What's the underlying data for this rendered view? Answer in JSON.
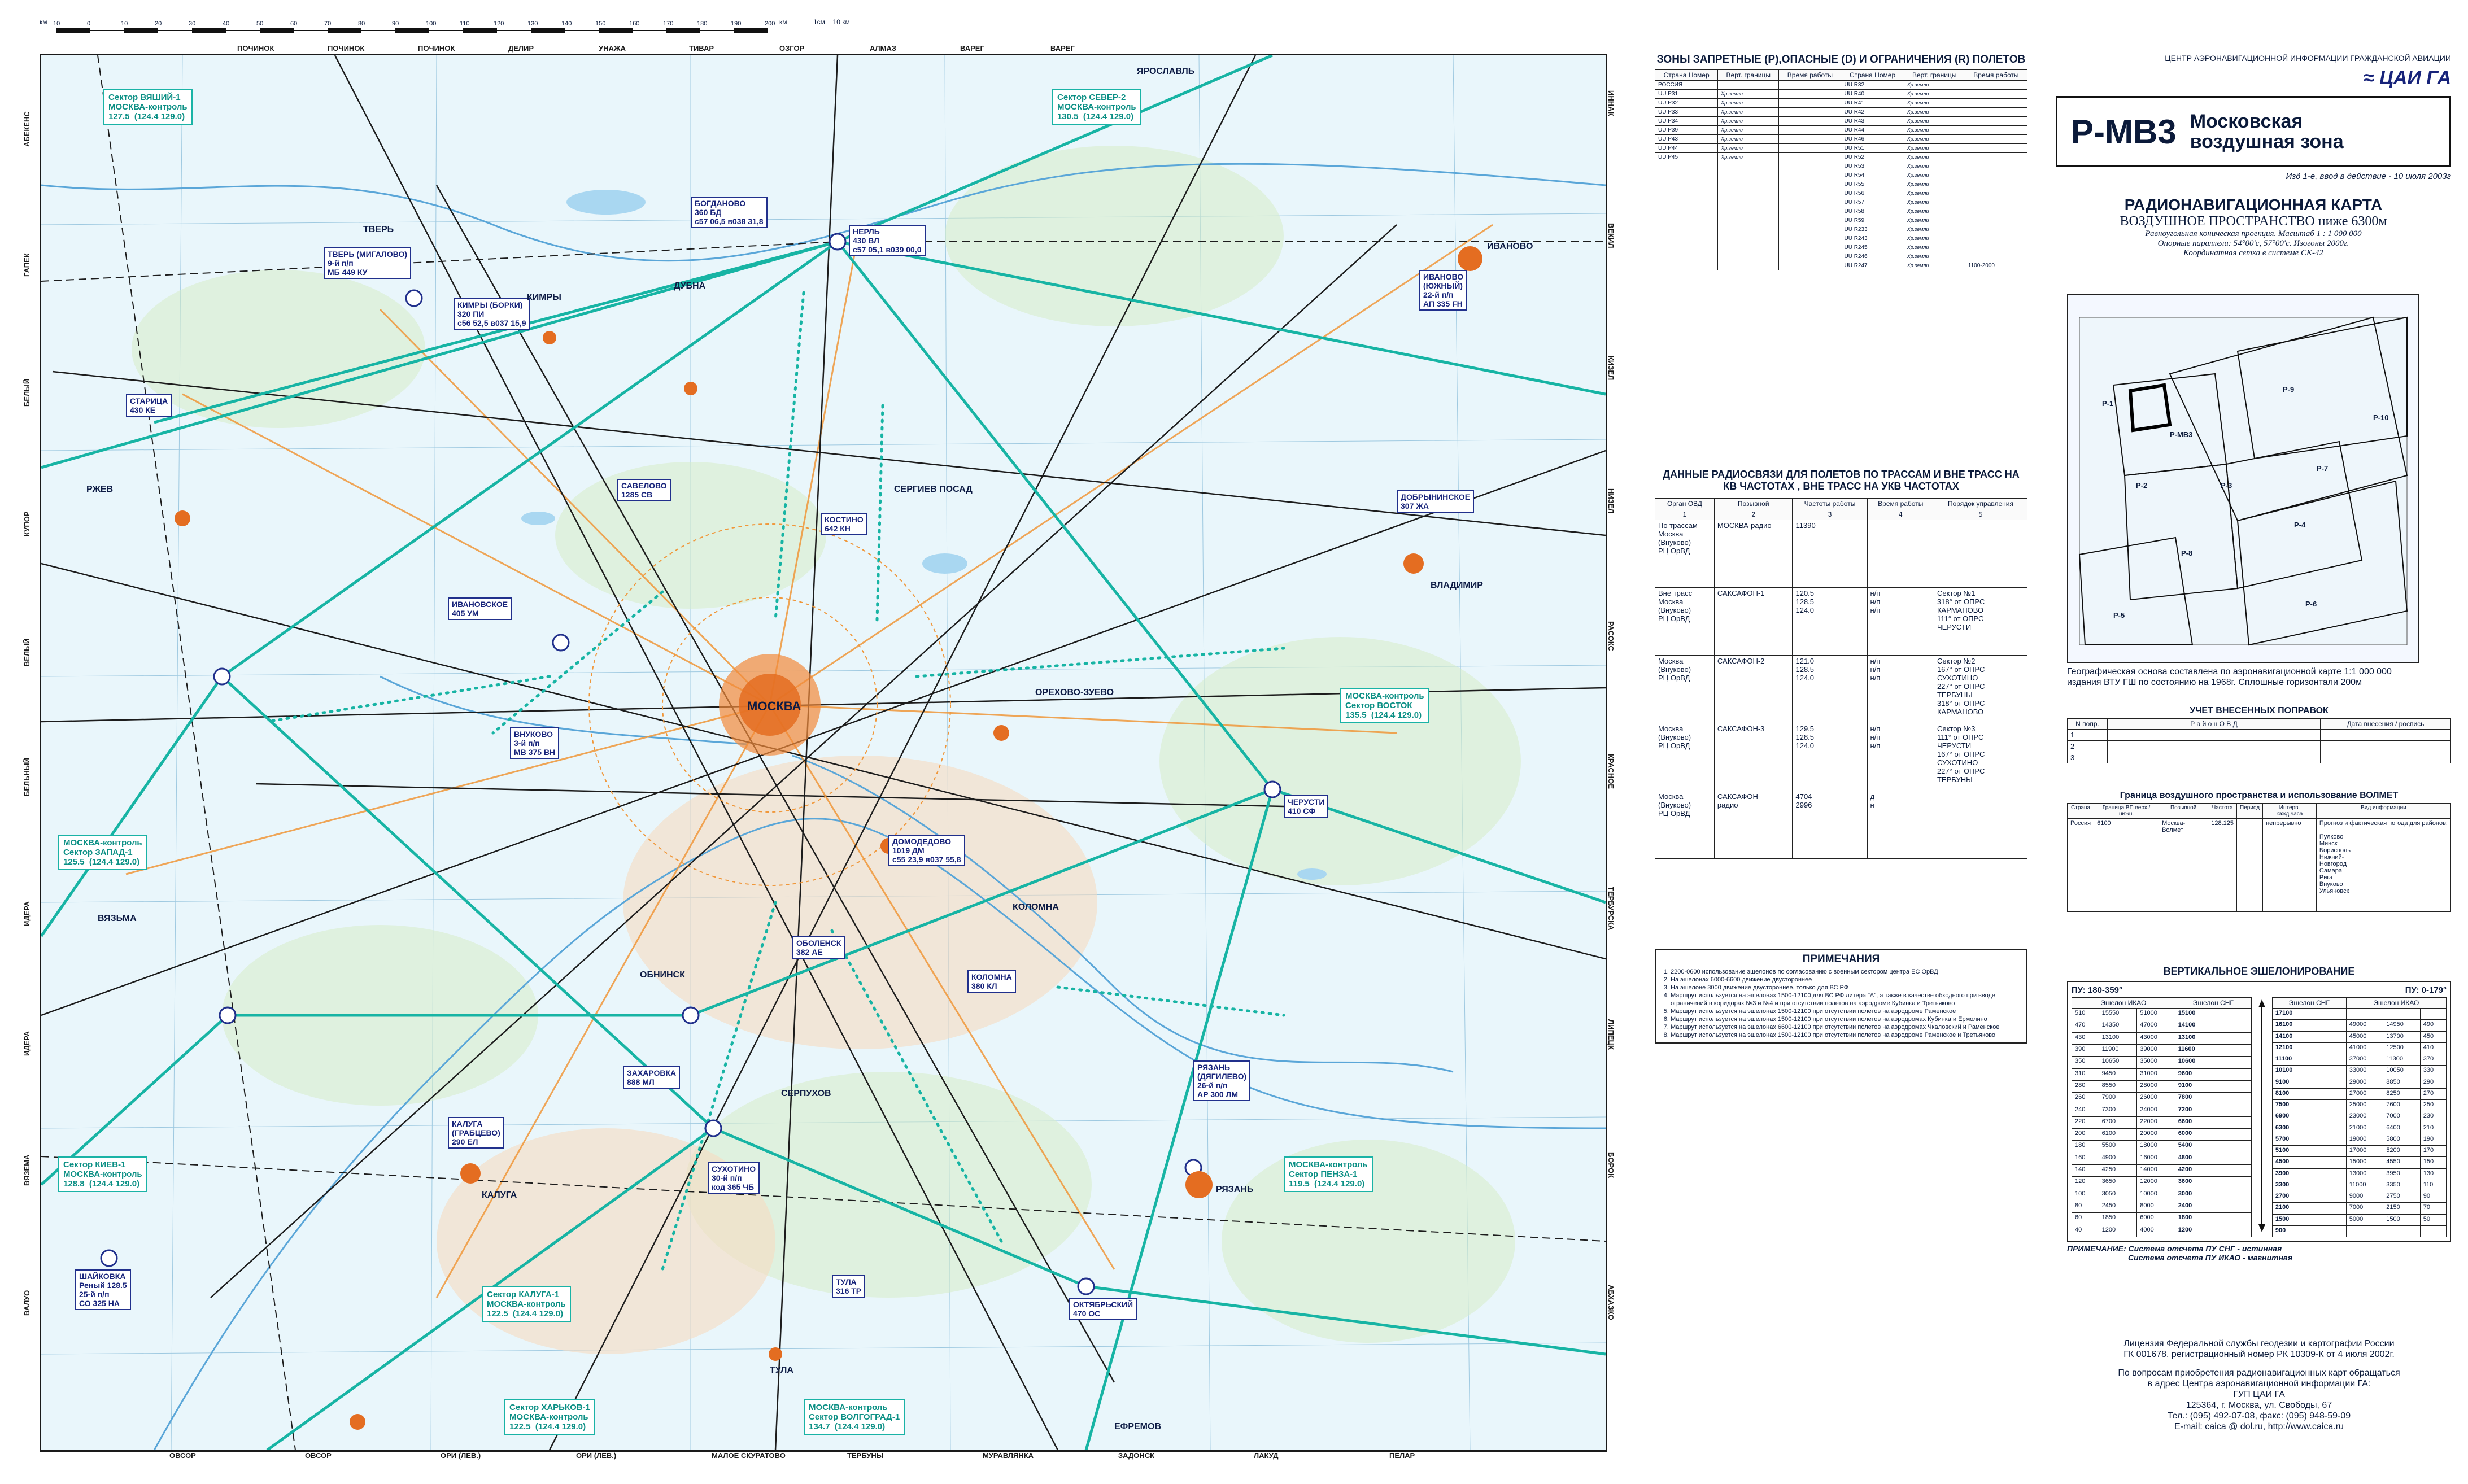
{
  "scale": {
    "label_km": "км",
    "ticks": [
      "10",
      "0",
      "10",
      "20",
      "30",
      "40",
      "50",
      "60",
      "70",
      "80",
      "90",
      "100",
      "110",
      "120",
      "130",
      "140",
      "150",
      "160",
      "170",
      "180",
      "190",
      "200"
    ],
    "unit_right": "км",
    "ratio_note": "1см = 10 км"
  },
  "edge_labels": {
    "top": [
      "ПОЧИНОК",
      "ПОЧИНОК",
      "ПОЧИНОК",
      "ДЕЛИР",
      "УНАЖА",
      "ТИВАР",
      "ОЗГОР",
      "АЛМАЗ",
      "ВАРЕГ",
      "ВАРЕГ"
    ],
    "bottom": [
      "ОВСОР",
      "ОВСОР",
      "ОРИ (ЛЕВ.)",
      "ОРИ (ЛЕВ.)",
      "МАЛОЕ СКУРАТОВО",
      "ТЕРБУНЫ",
      "МУРАВЛЯНКА",
      "ЗАДОНСК",
      "ЛАКУД",
      "ПЕЛАР"
    ],
    "left": [
      "АБЕКЕНС",
      "ГАПЕК",
      "БЕЛЫЙ",
      "КУПОР",
      "ВЕЛЫЙ",
      "БЕЛЬНЫЙ",
      "ИДЕРА",
      "ИДЕРА",
      "ВЯЗЕМА",
      "ВАЛУО"
    ],
    "right": [
      "ИННАК",
      "ВЕКИЛ",
      "КИЗЕЛ",
      "НИЗЕЛ",
      "РАСОКС",
      "КРАСНОЕ",
      "ТЕРБУРСКА",
      "ЛИПЕЦК",
      "БОРОК",
      "АБХАЗКО"
    ]
  },
  "stations": [
    {
      "id": "boldanovo",
      "text": "БОГДАНОВО\n360 БД\nс57 06,5 в038 31,8"
    },
    {
      "id": "nerl",
      "text": "НЕРЛЬ\n430 ВЛ\nс57 05,1 в039 00,0"
    },
    {
      "id": "tver",
      "text": "ТВЕРЬ (МИГАЛОВО)\n9-й п/п\nМБ 449 КУ"
    },
    {
      "id": "staritsa",
      "text": "СТАРИЦА\n430 КЕ"
    },
    {
      "id": "kimry",
      "text": "КИМРЫ (БОРКИ)\n320 ПИ\nс56 52,5 в037 15,9"
    },
    {
      "id": "savelovo",
      "text": "САВЕЛОВО\n1285 СВ"
    },
    {
      "id": "kostino",
      "text": "КОСТИНО\n642 КН"
    },
    {
      "id": "ivanovo",
      "text": "ИВАНОВО\n(ЮЖНЫЙ)\n22-й п/п\nАП 335 FH"
    },
    {
      "id": "dobryninskoe",
      "text": "ДОБРЫНИНСКОЕ\n307 ЖА"
    },
    {
      "id": "ivanovskoe",
      "text": "ИВАНОВСКОЕ\n405 УМ"
    },
    {
      "id": "cherusti",
      "text": "ЧЕРУСТИ\n410 СФ"
    },
    {
      "id": "oblast",
      "text": "ОБОЛЕНСК\n382 АЕ"
    },
    {
      "id": "zakharovka",
      "text": "ЗАХАРОВКА\n888 МЛ"
    },
    {
      "id": "kaluga",
      "text": "КАЛУГА\n(ГРАБЦЕВО)\n290 ЕЛ"
    },
    {
      "id": "dom",
      "text": "ДОМОДЕДОВО\n1019 ДМ\nс55 23,9 в037 55,8"
    },
    {
      "id": "kolomna",
      "text": "КОЛОМНА\n380 КЛ"
    },
    {
      "id": "ryazan",
      "text": "РЯЗАНЬ\n(ДЯГИЛЕВО)\n26-й п/п\nАР 300 ЛМ"
    },
    {
      "id": "sukhotino",
      "text": "СУХОТИНО\n30-й п/п\nкод 365 ЧБ"
    },
    {
      "id": "oktyabr",
      "text": "ОКТЯБРЬСКИЙ\n470 ОС"
    },
    {
      "id": "shaikovka",
      "text": "ШАЙКОВКА\nРеный 128.5\n25-й п/п\nСО 325 НА"
    },
    {
      "id": "vnukovo",
      "text": "ВНУКОВО\n3-й п/п\nМВ 375 ВН"
    },
    {
      "id": "tula",
      "text": "ТУЛА\n316 ТР"
    }
  ],
  "freq_boxes": [
    {
      "id": "tver_ctrl",
      "text": "Сектор ВЯШИЙ-1\nМОСКВА-контроль\n127.5  (124.4 129.0)"
    },
    {
      "id": "moskva_top",
      "text": "Сектор СЕВЕР-2\nМОСКВА-контроль\n130.5  (124.4 129.0)"
    },
    {
      "id": "moskva_west",
      "text": "МОСКВА-контроль\nСектор ЗАПАД-1\n125.5  (124.4 129.0)"
    },
    {
      "id": "moskva_east",
      "text": "МОСКВА-контроль\nСектор ВОСТОК\n135.5  (124.4 129.0)"
    },
    {
      "id": "moskva_kiev",
      "text": "Сектор КИЕВ-1\nМОСКВА-контроль\n128.8  (124.4 129.0)"
    },
    {
      "id": "moskva_kaluga",
      "text": "Сектор КАЛУГА-1\nМОСКВА-контроль\n122.5  (124.4 129.0)"
    },
    {
      "id": "moskva_south",
      "text": "МОСКВА-контроль\nСектор ПЕНЗА-1\n119.5  (124.4 129.0)"
    },
    {
      "id": "moskva_kharkov",
      "text": "Сектор ХАРЬКОВ-1\nМОСКВА-контроль\n122.5  (124.4 129.0)"
    },
    {
      "id": "moskva_volgograd",
      "text": "МОСКВА-контроль\nСектор ВОЛГОГРАД-1\n134.7  (124.4 129.0)"
    }
  ],
  "cities": [
    "ТВЕРЬ",
    "КИМРЫ",
    "ДУБНА",
    "ИВАНОВО",
    "ВЛАДИМИР",
    "МОСКВА",
    "СЕРГИЕВ ПОСАД",
    "РЯЗАНЬ",
    "КАЛУГА",
    "ТУЛА",
    "СЕРПУХОВ",
    "КОЛОМНА",
    "ОРЕХОВО-ЗУЕВО",
    "ЯРОСЛАВЛЬ",
    "РЖЕВ",
    "ВЯЗЬМА",
    "ОБНИНСК",
    "ЕФРЕМОВ"
  ],
  "header": {
    "agency": "ЦЕНТР АЭРОНАВИГАЦИОННОЙ ИНФОРМАЦИИ ГРАЖДАНСКОЙ АВИАЦИИ",
    "logo": "ЦАИ ГА",
    "code": "Р-МВ3",
    "zone": "Московская воздушная зона",
    "edition": "Изд 1-е, ввод в действие - 10 июля 2003г"
  },
  "chart_title": {
    "line1": "РАДИОНАВИГАЦИОННАЯ КАРТА",
    "line2": "ВОЗДУШНОЕ ПРОСТРАНСТВО ниже 6300м",
    "line3": "Равноугольная коническая проекция. Масштаб  1 : 1 000 000",
    "line4": "Опорные параллели: 54°00'с, 57°00'с. Изогоны 2000г.",
    "line5": "Координатная сетка в системе СК-42"
  },
  "index_map": {
    "labels": [
      "Р-1",
      "Р-9",
      "Р-МВ3",
      "Р-2",
      "Р-3",
      "Р-4",
      "Р-7",
      "Р-8",
      "Р-5",
      "Р-6",
      "Р-10"
    ],
    "note": "Географическая основа составлена по аэронавигационной карте 1:1 000 000 издания ВТУ ГШ по состоянию на 1968г. Сплошные горизонтали 200м"
  },
  "zones_table": {
    "title": "ЗОНЫ ЗАПРЕТНЫЕ (Р),ОПАСНЫЕ (D) И ОГРАНИЧЕНИЯ (R) ПОЛЕТОВ",
    "headers": [
      "Страна Номер",
      "Верт. границы",
      "Время работы",
      "Страна Номер",
      "Верт. границы",
      "Время работы"
    ],
    "country": "РОССИЯ",
    "left": [
      "UU P31",
      "UU P32",
      "UU P33",
      "UU P34",
      "UU P39",
      "UU P43",
      "UU P44",
      "UU P45"
    ],
    "right": [
      "UU R32",
      "UU R40",
      "UU R41",
      "UU R42",
      "UU R43",
      "UU R44",
      "UU R46",
      "UU R51",
      "UU R52",
      "UU R53",
      "UU R54",
      "UU R55",
      "UU R56",
      "UU R57",
      "UU R58",
      "UU R59",
      "UU R233",
      "UU R243",
      "UU R245",
      "UU R246",
      "UU R247"
    ],
    "limit": "Хр.земли",
    "last_time": "1100-2000"
  },
  "radio_table": {
    "title": "ДАННЫЕ РАДИОСВЯЗИ ДЛЯ ПОЛЕТОВ ПО ТРАССАМ И ВНЕ ТРАСС НА КВ ЧАСТОТАХ , ВНЕ ТРАСС  НА УКВ ЧАСТОТАХ",
    "headers": [
      "Орган ОВД",
      "Позывной",
      "Частоты работы",
      "Время работы",
      "Порядок управления"
    ],
    "numbers": [
      "1",
      "2",
      "3",
      "4",
      "5"
    ],
    "rows": [
      {
        "organ": "По трассам\nМосква\n(Внуково)\nРЦ ОрВД",
        "call": "МОСКВА-радио",
        "freq": "11390",
        "time": "",
        "order": ""
      },
      {
        "organ": "Вне трасс\nМосква\n(Внуково)\nРЦ ОрВД",
        "call": "САКСАФОН-1",
        "freq": "120.5\n128.5\n124.0",
        "time": "н/п\nн/п\nн/п",
        "order": "Сектор №1\n318° от ОПРС\nКАРМАНОВО\n111° от ОПРС\nЧЕРУСТИ"
      },
      {
        "organ": "Москва\n(Внуково)\nРЦ ОрВД",
        "call": "САКСАФОН-2",
        "freq": "121.0\n128.5\n124.0",
        "time": "н/п\nн/п\nн/п",
        "order": "Сектор №2\n167° от ОПРС\nСУХОТИНО\n227° от ОПРС\nТЕРБУНЫ\n318° от ОПРС\nКАРМАНОВО"
      },
      {
        "organ": "Москва\n(Внуково)\nРЦ ОрВД",
        "call": "САКСАФОН-3",
        "freq": "129.5\n128.5\n124.0",
        "time": "н/п\nн/п\nн/п",
        "order": "Сектор №3\n111° от ОПРС\nЧЕРУСТИ\n167° от ОПРС\nСУХОТИНО\n227° от ОПРС\nТЕРБУНЫ"
      },
      {
        "organ": "Москва\n(Внуково)\nРЦ ОрВД",
        "call": "САКСАФОН-\nрадио",
        "freq": "4704\n2996",
        "time": "д\nн",
        "order": ""
      }
    ]
  },
  "notes": {
    "title": "ПРИМЕЧАНИЯ",
    "items": [
      "2200-0600 использование эшелонов по согласованию с военным сектором центра ЕС ОрВД",
      "На эшелонах 6000-6600 движение двустороннее",
      "На эшелоне 3000 движение двустороннее, только для ВС РФ",
      "Маршрут используется на эшелонах 1500-12100 для ВС РФ литера \"А\", а также в качестве обходного при вводе ограничений в коридорах №3 и №4 и при отсутствии полетов на аэродроме Кубинка и Третьяково",
      "Маршрут используется на эшелонах 1500-12100 при отсутствии полетов на аэродроме Раменское",
      "Маршрут используется на эшелонах 1500-12100 при отсутствии полетов на аэродромах Кубинка и Ермолино",
      "Маршрут используется на эшелонах 6600-12100  при отсутствии полетов на аэродромах Чкаловский и Раменское",
      "Маршрут используется на эшелонах 1500-12100 при отсутствии полетов на аэродроме Раменское и Третьяково"
    ]
  },
  "amendments": {
    "title": "УЧЕТ ВНЕСЕННЫХ ПОПРАВОК",
    "headers": [
      "N попр.",
      "Р а й о н   О В Д",
      "Дата внесения / роспись"
    ],
    "rows": [
      "1",
      "2",
      "3"
    ]
  },
  "volmet": {
    "title": "Граница воздушного пространства и использование ВОЛМЕТ",
    "headers": [
      "Страна",
      "Граница ВП верх./нижн.",
      "Позывной",
      "Частота",
      "Период",
      "Интерв. кажд.часа",
      "Вид информации"
    ],
    "row": {
      "country": "Россия",
      "limit": "6100",
      "call": "Москва-Волмет",
      "freq": "128.125",
      "period": "",
      "interval": "непрерывно",
      "info": "Прогноз и фактическая погода для районов:\n\nПулково\nМинск\nБорисполь\nНижний-\nНовгород\nСамара\nРига\nВнуково\nУльяновск"
    }
  },
  "levels": {
    "title": "ВЕРТИКАЛЬНОЕ ЭШЕЛОНИРОВАНИЕ",
    "pu_left": "ПУ:  180-359°",
    "pu_right": "ПУ:  0-179°",
    "col_heads": [
      "Эшелон ИКАО",
      "Эшелон СНГ",
      "Эшелон СНГ",
      "Эшелон ИКАО"
    ],
    "sub_heads": [
      "номер",
      "метры",
      "футы",
      "метры",
      "",
      "метры",
      "футы",
      "метры",
      "номер"
    ],
    "left_rows": [
      [
        "510",
        "15550",
        "51000",
        "15100"
      ],
      [
        "470",
        "14350",
        "47000",
        "14100"
      ],
      [
        "430",
        "13100",
        "43000",
        "13100"
      ],
      [
        "390",
        "11900",
        "39000",
        "11600"
      ],
      [
        "350",
        "10650",
        "35000",
        "10600"
      ],
      [
        "310",
        "9450",
        "31000",
        "9600"
      ],
      [
        "280",
        "8550",
        "28000",
        "9100"
      ],
      [
        "260",
        "7900",
        "26000",
        "7800"
      ],
      [
        "240",
        "7300",
        "24000",
        "7200"
      ],
      [
        "220",
        "6700",
        "22000",
        "6600"
      ],
      [
        "200",
        "6100",
        "20000",
        "6000"
      ],
      [
        "180",
        "5500",
        "18000",
        "5400"
      ],
      [
        "160",
        "4900",
        "16000",
        "4800"
      ],
      [
        "140",
        "4250",
        "14000",
        "4200"
      ],
      [
        "120",
        "3650",
        "12000",
        "3600"
      ],
      [
        "100",
        "3050",
        "10000",
        "3000"
      ],
      [
        "80",
        "2450",
        "8000",
        "2400"
      ],
      [
        "60",
        "1850",
        "6000",
        "1800"
      ],
      [
        "40",
        "1200",
        "4000",
        "1200"
      ]
    ],
    "right_rows": [
      [
        "17100",
        "",
        "",
        ""
      ],
      [
        "16100",
        "49000",
        "14950",
        "490"
      ],
      [
        "14100",
        "45000",
        "13700",
        "450"
      ],
      [
        "12100",
        "41000",
        "12500",
        "410"
      ],
      [
        "11100",
        "37000",
        "11300",
        "370"
      ],
      [
        "10100",
        "33000",
        "10050",
        "330"
      ],
      [
        "9100",
        "29000",
        "8850",
        "290"
      ],
      [
        "8100",
        "27000",
        "8250",
        "270"
      ],
      [
        "7500",
        "25000",
        "7600",
        "250"
      ],
      [
        "6900",
        "23000",
        "7000",
        "230"
      ],
      [
        "6300",
        "21000",
        "6400",
        "210"
      ],
      [
        "5700",
        "19000",
        "5800",
        "190"
      ],
      [
        "5100",
        "17000",
        "5200",
        "170"
      ],
      [
        "4500",
        "15000",
        "4550",
        "150"
      ],
      [
        "3900",
        "13000",
        "3950",
        "130"
      ],
      [
        "3300",
        "11000",
        "3350",
        "110"
      ],
      [
        "2700",
        "9000",
        "2750",
        "90"
      ],
      [
        "2100",
        "7000",
        "2150",
        "70"
      ],
      [
        "1500",
        "5000",
        "1500",
        "50"
      ],
      [
        "900",
        "",
        "",
        ""
      ]
    ],
    "note1": "ПРИМЕЧАНИЕ:   Система отсчета  ПУ  СНГ - истинная",
    "note2": "Система отсчета  ПУ  ИКАО - магнитная"
  },
  "footer": {
    "license1": "Лицензия Федеральной службы геодезии и картографии России",
    "license2": "ГК 001678, регистрационный номер РК 10309-К от 4 июля 2002г.",
    "buy1": "По вопросам приобретения радионавигационных карт обращаться",
    "buy2": "в адрес Центра аэронавигационной информации ГА:",
    "org": "ГУП  ЦАИ ГА",
    "addr": "125364, г. Москва,  ул. Свободы, 67",
    "tel": "Тел.: (095) 492-07-08,  факс: (095) 948-59-09",
    "email": "E-mail: caica @ dol.ru, http://www.caica.ru"
  }
}
